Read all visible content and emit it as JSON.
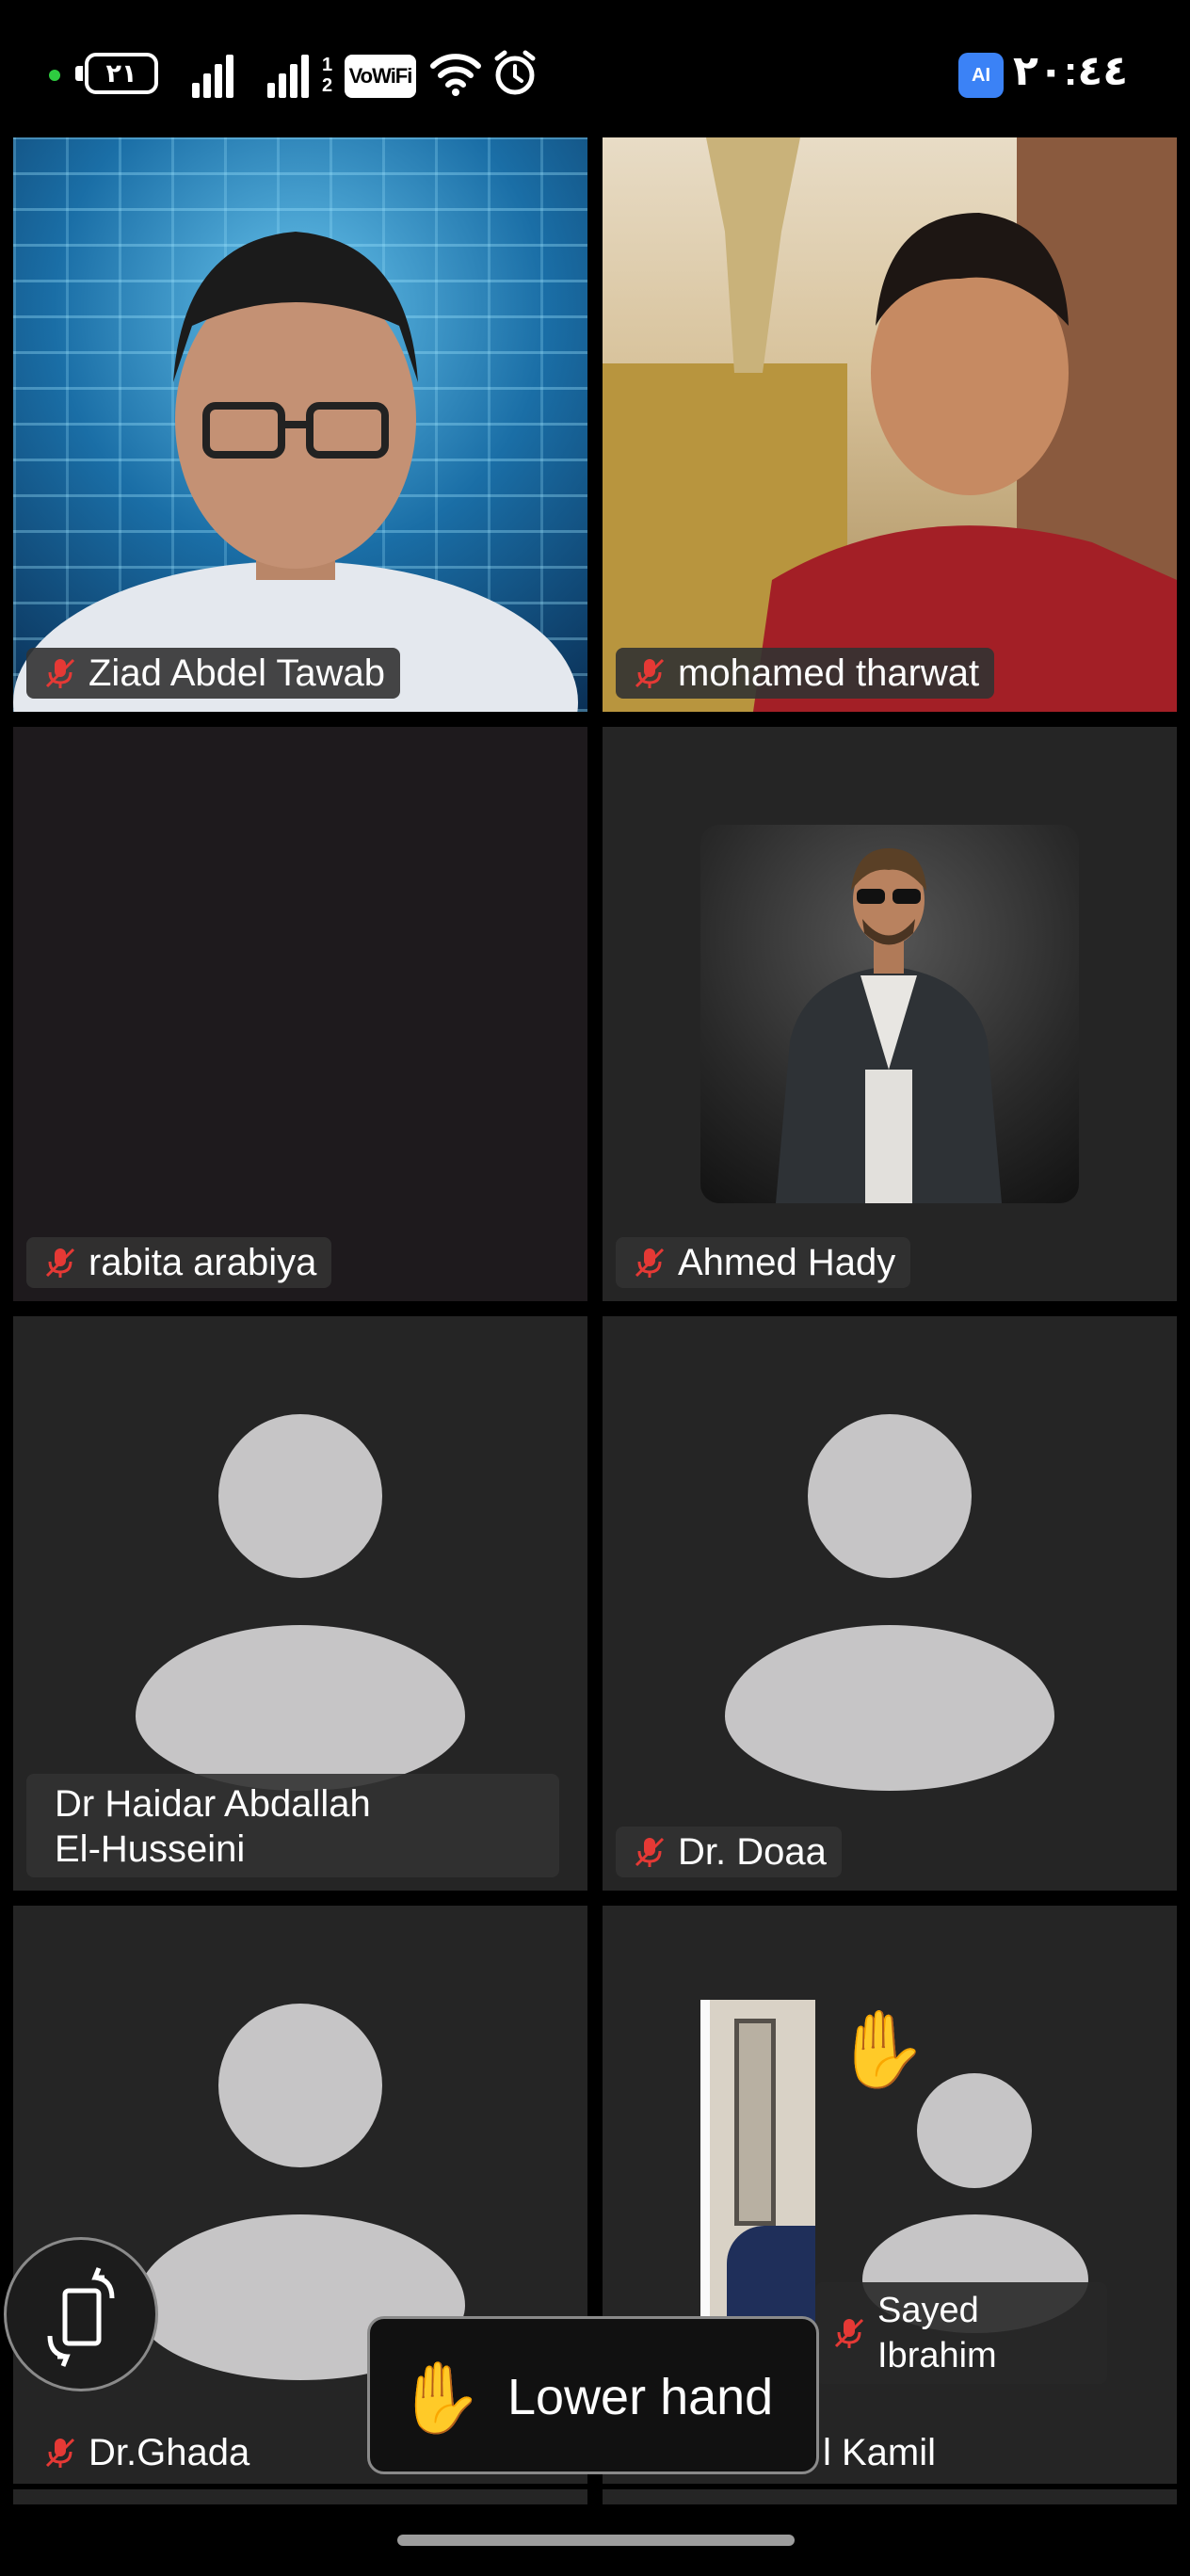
{
  "status_bar": {
    "battery": "٢١",
    "sim2_label": "1\n2",
    "vowifi": "VoWiFi",
    "ai_badge": "AI",
    "time": "٢٠:٤٤"
  },
  "participants": [
    {
      "name": "Ziad Abdel Tawab",
      "muted": true,
      "view": "video"
    },
    {
      "name": "mohamed tharwat",
      "muted": true,
      "view": "video"
    },
    {
      "name": "rabita arabiya",
      "muted": true,
      "view": "blank"
    },
    {
      "name": "Ahmed Hady",
      "muted": true,
      "view": "photo"
    },
    {
      "name_line1": "Dr Haidar Abdallah",
      "name_line2": "El-Husseini",
      "muted": false,
      "view": "avatar"
    },
    {
      "name": "Dr. Doaa",
      "muted": true,
      "view": "avatar"
    },
    {
      "name": "Dr.Ghada",
      "muted": true,
      "view": "avatar"
    },
    {
      "name": "l Kamil",
      "muted": false,
      "view": "video-partial"
    }
  ],
  "pip": {
    "name_line1": "Sayed",
    "name_line2": "Ibrahim",
    "muted": true,
    "hand_raised": true
  },
  "controls": {
    "lower_hand_label": "Lower hand",
    "hand_icon": "raised-hand-icon",
    "rotate_icon": "rotate-screen-icon"
  },
  "colors": {
    "tile_bg": "#252525",
    "avatar": "#c6c5c6",
    "muted_mic": "#e53935"
  }
}
